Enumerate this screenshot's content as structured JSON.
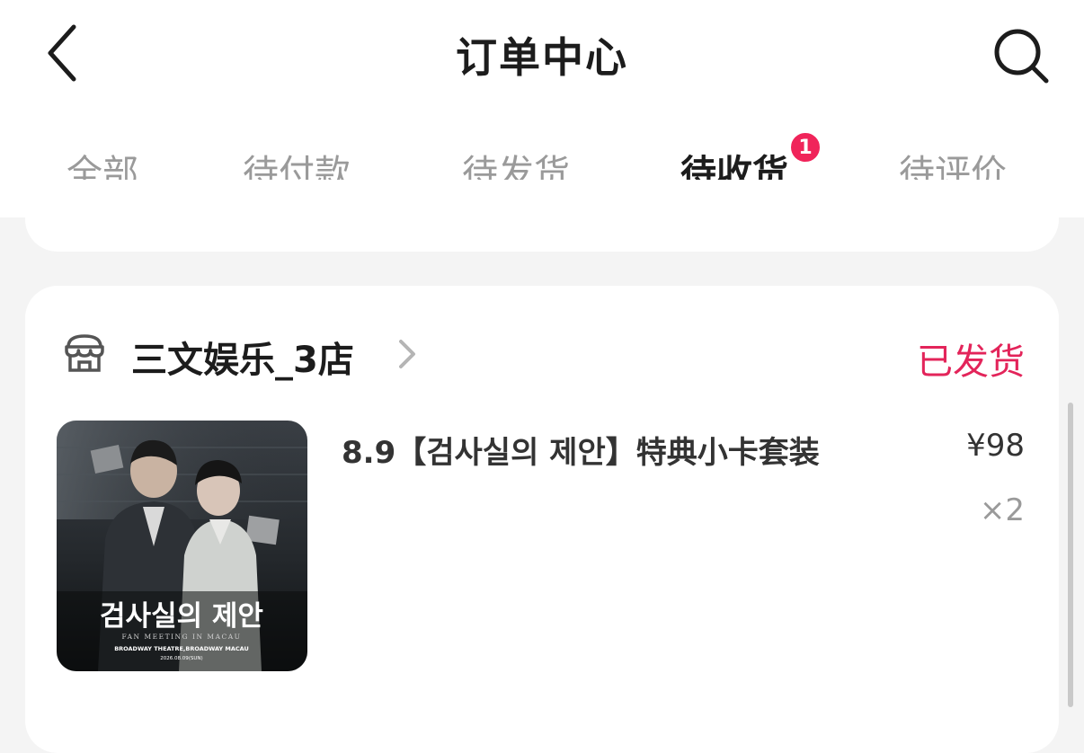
{
  "header": {
    "title": "订单中心",
    "back_icon": "chevron-left-icon",
    "search_icon": "search-icon"
  },
  "tabs": [
    {
      "label": "全部",
      "active": false
    },
    {
      "label": "待付款",
      "active": false
    },
    {
      "label": "待发货",
      "active": false
    },
    {
      "label": "待收货",
      "active": true,
      "badge": "1"
    },
    {
      "label": "待评价",
      "active": false
    }
  ],
  "order": {
    "shop_icon": "store-icon",
    "shop_name": "三文娱乐_3店",
    "status": "已发货",
    "product": {
      "title": "8.9【검사실의 제안】特典小卡套装",
      "price": "¥98",
      "quantity": "×2",
      "thumbnail": {
        "headline": "검사실의 제안",
        "subline": "FAN MEETING IN MACAU",
        "venue": "BROADWAY THEATRE,BROADWAY MACAU",
        "date": "2026.08.09(SUN)"
      }
    }
  },
  "colors": {
    "accent": "#f0245a",
    "status": "#e3245a",
    "background": "#f4f4f4"
  }
}
